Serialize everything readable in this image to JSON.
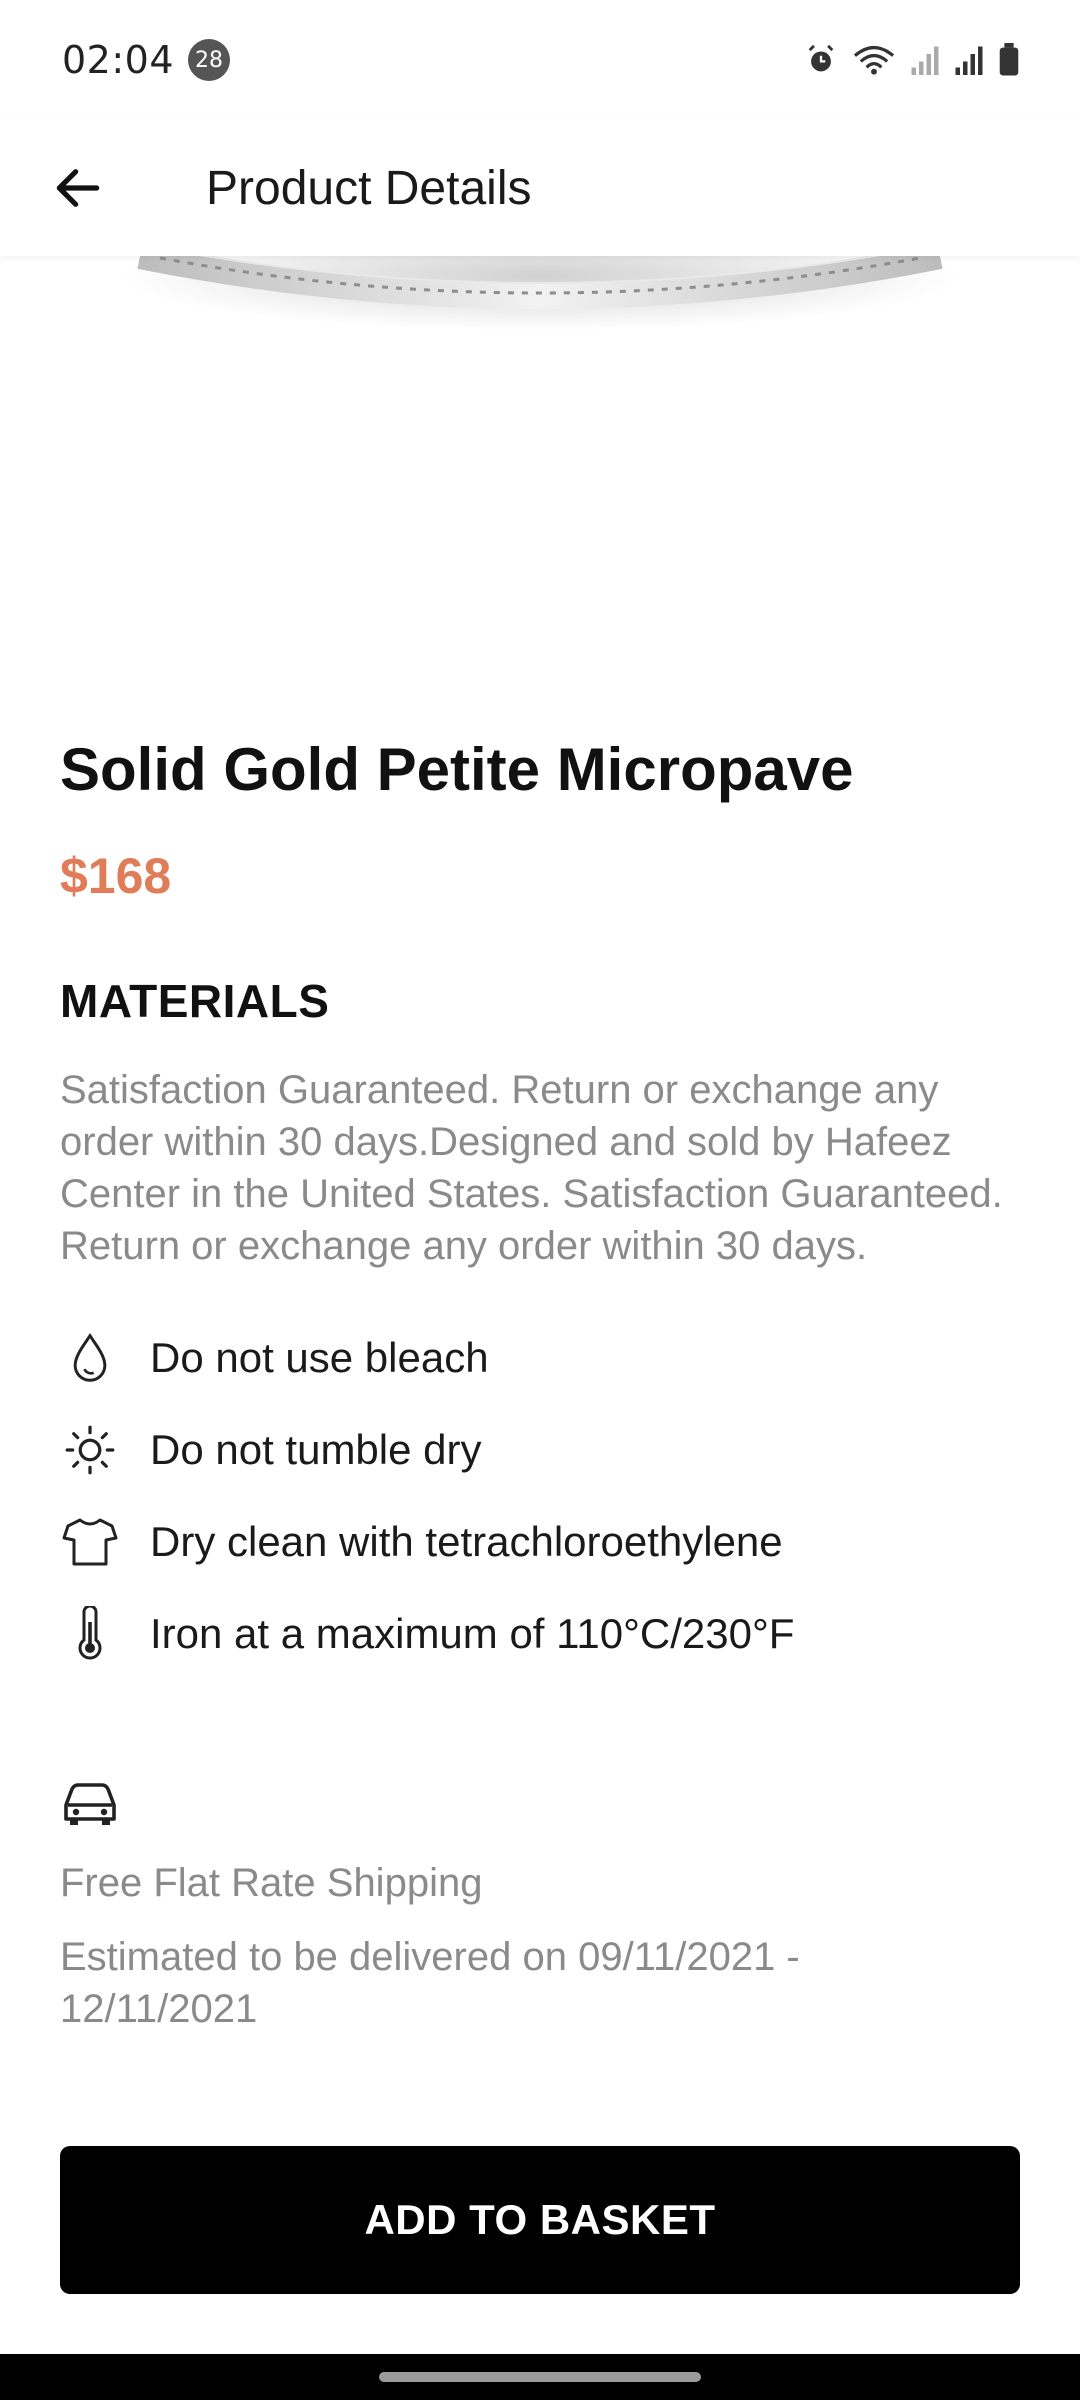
{
  "status_bar": {
    "time": "02:04",
    "notification_count": "28",
    "icons": [
      "alarm-icon",
      "wifi-icon",
      "signal-icon",
      "signal-icon",
      "battery-icon"
    ]
  },
  "app_bar": {
    "back_icon": "arrow-left-icon",
    "title": "Product Details"
  },
  "product": {
    "name": "Solid Gold Petite Micropave",
    "price": "$168",
    "price_color": "#e07c57"
  },
  "materials": {
    "title": "MATERIALS",
    "description": "Satisfaction Guaranteed. Return or exchange any order within 30 days.Designed and sold by Hafeez Center in the United States. Satisfaction Guaranteed. Return or exchange any order within 30 days."
  },
  "care": [
    {
      "icon": "water-drop-icon",
      "label": "Do not use bleach"
    },
    {
      "icon": "sun-icon",
      "label": "Do not tumble dry"
    },
    {
      "icon": "tshirt-icon",
      "label": "Dry clean with tetrachloroethylene"
    },
    {
      "icon": "thermometer-icon",
      "label": "Iron at a maximum of 110°C/230°F"
    }
  ],
  "shipping": {
    "icon": "car-icon",
    "title": "Free Flat Rate Shipping",
    "estimate": "Estimated to be delivered on 09/11/2021 - 12/11/2021"
  },
  "cta": {
    "label": "ADD TO BASKET"
  }
}
